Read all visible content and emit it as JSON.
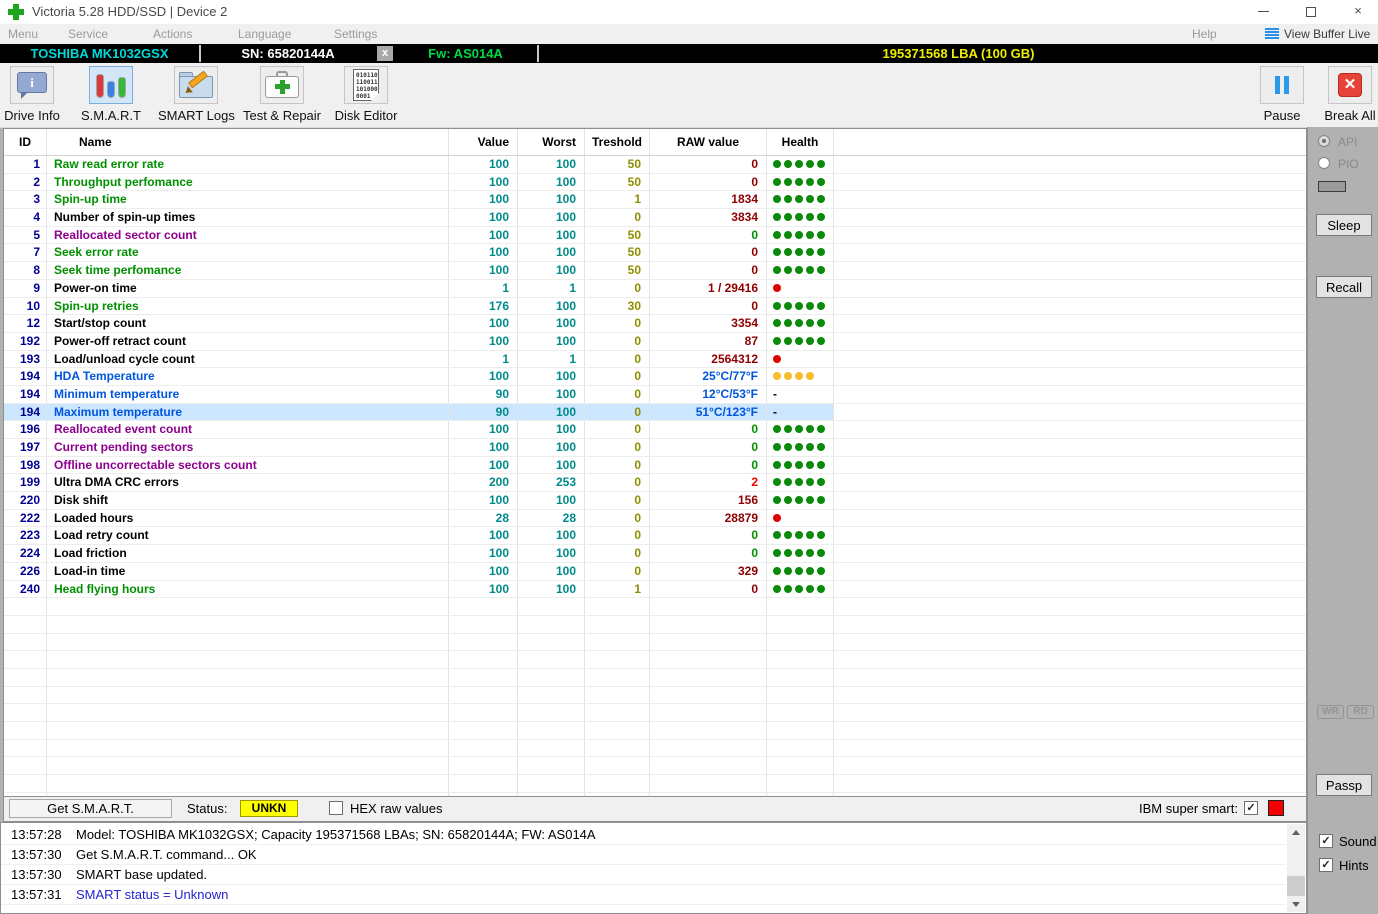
{
  "window": {
    "title": "Victoria 5.28 HDD/SSD | Device 2"
  },
  "menubar": {
    "items": [
      "Menu",
      "Service",
      "Actions",
      "Language",
      "Settings"
    ],
    "help": "Help",
    "view_buffer_live": "View Buffer Live"
  },
  "device_bar": {
    "model": "TOSHIBA MK1032GSX",
    "serial": "SN: 65820144A",
    "close": "x",
    "firmware": "Fw: AS014A",
    "capacity": "195371568 LBA (100 GB)"
  },
  "toolbar": {
    "buttons": [
      {
        "label": "Drive Info"
      },
      {
        "label": "S.M.A.R.T"
      },
      {
        "label": "SMART Logs"
      },
      {
        "label": "Test & Repair"
      },
      {
        "label": "Disk Editor"
      }
    ],
    "binary_icon_lines": "010110\n110011\n101000\n0001",
    "pause": "Pause",
    "break_all": "Break All"
  },
  "smart_table": {
    "columns": [
      "ID",
      "Name",
      "Value",
      "Worst",
      "Treshold",
      "RAW value",
      "Health"
    ],
    "rows": [
      {
        "id": "1",
        "name": "Raw read error rate",
        "name_color": "green",
        "value": "100",
        "worst": "100",
        "treshold": "50",
        "raw": "0",
        "raw_color": "darkred",
        "health": "g5"
      },
      {
        "id": "2",
        "name": "Throughput perfomance",
        "name_color": "green",
        "value": "100",
        "worst": "100",
        "treshold": "50",
        "raw": "0",
        "raw_color": "darkred",
        "health": "g5"
      },
      {
        "id": "3",
        "name": "Spin-up time",
        "name_color": "green",
        "value": "100",
        "worst": "100",
        "treshold": "1",
        "raw": "1834",
        "raw_color": "darkred",
        "health": "g5"
      },
      {
        "id": "4",
        "name": "Number of spin-up times",
        "name_color": "black",
        "value": "100",
        "worst": "100",
        "treshold": "0",
        "raw": "3834",
        "raw_color": "darkred",
        "health": "g5"
      },
      {
        "id": "5",
        "name": "Reallocated sector count",
        "name_color": "purple",
        "value": "100",
        "worst": "100",
        "treshold": "50",
        "raw": "0",
        "raw_color": "green",
        "health": "g5"
      },
      {
        "id": "7",
        "name": "Seek error rate",
        "name_color": "green",
        "value": "100",
        "worst": "100",
        "treshold": "50",
        "raw": "0",
        "raw_color": "darkred",
        "health": "g5"
      },
      {
        "id": "8",
        "name": "Seek time perfomance",
        "name_color": "green",
        "value": "100",
        "worst": "100",
        "treshold": "50",
        "raw": "0",
        "raw_color": "darkred",
        "health": "g5"
      },
      {
        "id": "9",
        "name": "Power-on time",
        "name_color": "black",
        "value": "1",
        "worst": "1",
        "treshold": "0",
        "raw": "1 / 29416",
        "raw_color": "darkred",
        "health": "r1"
      },
      {
        "id": "10",
        "name": "Spin-up retries",
        "name_color": "green",
        "value": "176",
        "worst": "100",
        "treshold": "30",
        "raw": "0",
        "raw_color": "darkred",
        "health": "g5"
      },
      {
        "id": "12",
        "name": "Start/stop count",
        "name_color": "black",
        "value": "100",
        "worst": "100",
        "treshold": "0",
        "raw": "3354",
        "raw_color": "darkred",
        "health": "g5"
      },
      {
        "id": "192",
        "name": "Power-off retract count",
        "name_color": "black",
        "value": "100",
        "worst": "100",
        "treshold": "0",
        "raw": "87",
        "raw_color": "darkred",
        "health": "g5"
      },
      {
        "id": "193",
        "name": "Load/unload cycle count",
        "name_color": "black",
        "value": "1",
        "worst": "1",
        "treshold": "0",
        "raw": "2564312",
        "raw_color": "darkred",
        "health": "r1"
      },
      {
        "id": "194",
        "name": "HDA Temperature",
        "name_color": "blue",
        "value": "100",
        "worst": "100",
        "treshold": "0",
        "raw": "25°C/77°F",
        "raw_color": "blue",
        "health": "o4"
      },
      {
        "id": "194",
        "name": "Minimum temperature",
        "name_color": "blue",
        "value": "90",
        "worst": "100",
        "treshold": "0",
        "raw": "12°C/53°F",
        "raw_color": "blue",
        "health": "dash"
      },
      {
        "id": "194",
        "name": "Maximum temperature",
        "name_color": "blue",
        "value": "90",
        "worst": "100",
        "treshold": "0",
        "raw": "51°C/123°F",
        "raw_color": "blue",
        "health": "dash",
        "selected": true
      },
      {
        "id": "196",
        "name": "Reallocated event count",
        "name_color": "purple",
        "value": "100",
        "worst": "100",
        "treshold": "0",
        "raw": "0",
        "raw_color": "green",
        "health": "g5"
      },
      {
        "id": "197",
        "name": "Current pending sectors",
        "name_color": "purple",
        "value": "100",
        "worst": "100",
        "treshold": "0",
        "raw": "0",
        "raw_color": "green",
        "health": "g5"
      },
      {
        "id": "198",
        "name": "Offline uncorrectable sectors count",
        "name_color": "purple",
        "value": "100",
        "worst": "100",
        "treshold": "0",
        "raw": "0",
        "raw_color": "green",
        "health": "g5"
      },
      {
        "id": "199",
        "name": "Ultra DMA CRC errors",
        "name_color": "black",
        "value": "200",
        "worst": "253",
        "treshold": "0",
        "raw": "2",
        "raw_color": "red",
        "health": "g5"
      },
      {
        "id": "220",
        "name": "Disk shift",
        "name_color": "black",
        "value": "100",
        "worst": "100",
        "treshold": "0",
        "raw": "156",
        "raw_color": "darkred",
        "health": "g5"
      },
      {
        "id": "222",
        "name": "Loaded hours",
        "name_color": "black",
        "value": "28",
        "worst": "28",
        "treshold": "0",
        "raw": "28879",
        "raw_color": "darkred",
        "health": "r1"
      },
      {
        "id": "223",
        "name": "Load retry count",
        "name_color": "black",
        "value": "100",
        "worst": "100",
        "treshold": "0",
        "raw": "0",
        "raw_color": "green",
        "health": "g5"
      },
      {
        "id": "224",
        "name": "Load friction",
        "name_color": "black",
        "value": "100",
        "worst": "100",
        "treshold": "0",
        "raw": "0",
        "raw_color": "green",
        "health": "g5"
      },
      {
        "id": "226",
        "name": "Load-in time",
        "name_color": "black",
        "value": "100",
        "worst": "100",
        "treshold": "0",
        "raw": "329",
        "raw_color": "darkred",
        "health": "g5"
      },
      {
        "id": "240",
        "name": "Head flying hours",
        "name_color": "green",
        "value": "100",
        "worst": "100",
        "treshold": "1",
        "raw": "0",
        "raw_color": "darkred",
        "health": "g5"
      }
    ]
  },
  "side_panel": {
    "api": "API",
    "pio": "PIO",
    "sleep": "Sleep",
    "recall": "Recall",
    "wr": "WR",
    "rd": "RD",
    "passp": "Passp",
    "sound": "Sound",
    "hints": "Hints"
  },
  "status_bar": {
    "get_smart": "Get S.M.A.R.T.",
    "status_label": "Status:",
    "status_value": "UNKN",
    "hex_label": "HEX raw values",
    "ibm_label": "IBM super smart:"
  },
  "log": {
    "entries": [
      {
        "time": "13:57:28",
        "message": "Model: TOSHIBA MK1032GSX; Capacity 195371568 LBAs; SN: 65820144A; FW: AS014A",
        "color": "black"
      },
      {
        "time": "13:57:30",
        "message": "Get S.M.A.R.T. command... OK",
        "color": "black"
      },
      {
        "time": "13:57:30",
        "message": "SMART base updated.",
        "color": "black"
      },
      {
        "time": "13:57:31",
        "message": "SMART status = Unknown",
        "color": "blue"
      }
    ]
  },
  "colors": {
    "green": "#009000",
    "purple": "#8e008e",
    "blue": "#0055dd",
    "black": "#000000",
    "darkred": "#8e0000",
    "red": "#ee0000",
    "teal": "#008a8a",
    "olive": "#8e8e00",
    "navy": "#000090",
    "dot_green": "#0a8a0a",
    "dot_red": "#e00000",
    "dot_orange": "#f8bc2c",
    "selected_bg": "#cce6ff",
    "model_cyan": "#00d9d9",
    "fw_green": "#00d948",
    "capacity_yellow": "#eeee00",
    "status_yellow": "#ffff00",
    "log_blue": "#2424cc"
  }
}
